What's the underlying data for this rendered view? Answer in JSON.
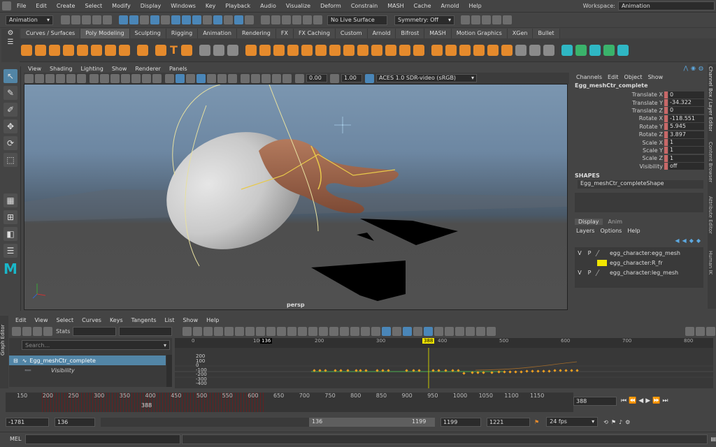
{
  "menubar": {
    "items": [
      "File",
      "Edit",
      "Create",
      "Select",
      "Modify",
      "Display",
      "Windows",
      "Key",
      "Playback",
      "Audio",
      "Visualize",
      "Deform",
      "Constrain",
      "MASH",
      "Cache",
      "Arnold",
      "Help"
    ],
    "workspace_label": "Workspace:",
    "workspace_value": "Animation"
  },
  "status": {
    "mode": "Animation",
    "live_surface": "No Live Surface",
    "symmetry": "Symmetry: Off"
  },
  "shelf": {
    "tabs": [
      "Curves / Surfaces",
      "Poly Modeling",
      "Sculpting",
      "Rigging",
      "Animation",
      "Rendering",
      "FX",
      "FX Caching",
      "Custom",
      "Arnold",
      "Bifrost",
      "MASH",
      "Motion Graphics",
      "XGen",
      "Bullet"
    ],
    "active_tab": "Poly Modeling"
  },
  "viewport": {
    "menu": [
      "View",
      "Shading",
      "Lighting",
      "Show",
      "Renderer",
      "Panels"
    ],
    "exposure": "0.00",
    "gamma": "1.00",
    "colorspace": "ACES 1.0 SDR-video (sRGB)",
    "camera_label": "persp"
  },
  "channelbox": {
    "menu": [
      "Channels",
      "Edit",
      "Object",
      "Show"
    ],
    "object": "Egg_meshCtr_complete",
    "channels": [
      {
        "name": "Translate X",
        "value": "0"
      },
      {
        "name": "Translate Y",
        "value": "-34.322"
      },
      {
        "name": "Translate Z",
        "value": "0"
      },
      {
        "name": "Rotate X",
        "value": "-118.551"
      },
      {
        "name": "Rotate Y",
        "value": "5.945"
      },
      {
        "name": "Rotate Z",
        "value": "3.897"
      },
      {
        "name": "Scale X",
        "value": "1"
      },
      {
        "name": "Scale Y",
        "value": "1"
      },
      {
        "name": "Scale Z",
        "value": "1"
      },
      {
        "name": "Visibility",
        "value": "off"
      }
    ],
    "shapes_header": "SHAPES",
    "shape": "Egg_meshCtr_completeShape"
  },
  "layers": {
    "tabs": [
      "Display",
      "Anim"
    ],
    "menu": [
      "Layers",
      "Options",
      "Help"
    ],
    "rows": [
      {
        "v": "V",
        "p": "P",
        "name": "egg_character:egg_mesh",
        "color": ""
      },
      {
        "v": "",
        "p": "",
        "name": "egg_character:R_fr",
        "color": "#f2e600"
      },
      {
        "v": "V",
        "p": "P",
        "name": "egg_character:leg_mesh",
        "color": ""
      }
    ]
  },
  "vertical_tabs": [
    "Channel Box / Layer Editor",
    "Content Browser",
    "Attribute Editor",
    "Human IK"
  ],
  "graph_editor": {
    "side_label": "Graph Editor",
    "menu": [
      "Edit",
      "View",
      "Select",
      "Curves",
      "Keys",
      "Tangents",
      "List",
      "Show",
      "Help"
    ],
    "stats_label": "Stats",
    "search_placeholder": "Search...",
    "outliner_item": "Egg_meshCtr_complete",
    "outliner_sub": "Visibility",
    "frame_ticks": [
      "0",
      "100",
      "200",
      "300",
      "400",
      "500",
      "600",
      "700",
      "800"
    ],
    "value_ticks": [
      "200",
      "100",
      "0",
      "-100",
      "-200",
      "-300",
      "-400"
    ],
    "current_frame": "388",
    "marker_frame": "136"
  },
  "timeslider": {
    "ticks": [
      "150",
      "200",
      "250",
      "300",
      "350",
      "400",
      "450",
      "500",
      "550",
      "600",
      "650",
      "700",
      "750",
      "800",
      "850",
      "900",
      "950",
      "1000",
      "1050",
      "1100",
      "1150"
    ],
    "current_frame": "388",
    "frame_field": "388"
  },
  "range": {
    "anim_start": "-1781",
    "start": "136",
    "range_start": "136",
    "range_end": "1199",
    "end": "1199",
    "anim_end": "1221",
    "fps": "24 fps"
  },
  "cmdline": {
    "label": "MEL"
  }
}
